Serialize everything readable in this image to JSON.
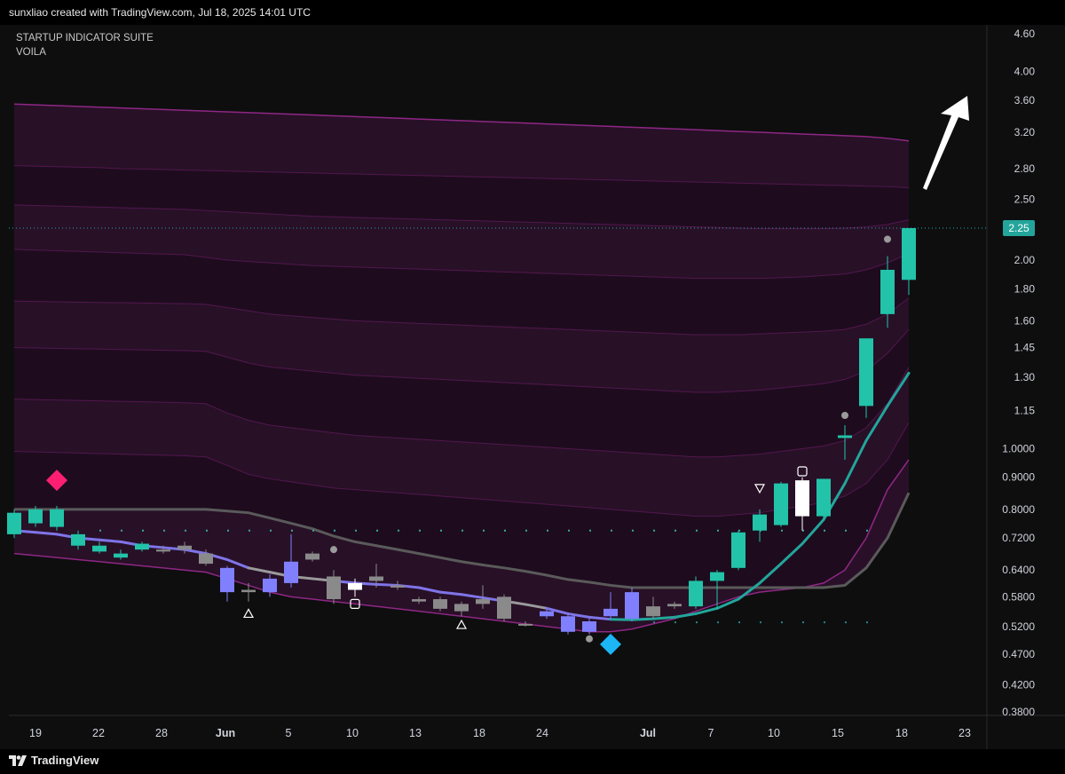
{
  "header": {
    "text": "sunxliao created with TradingView.com, Jul 18, 2025 14:01 UTC"
  },
  "legend": {
    "line1": "STARTUP INDICATOR SUITE",
    "line2": "VOILA"
  },
  "footer": {
    "brand": "TradingView"
  },
  "colors": {
    "bull": "#22c3a9",
    "bear_purple": "#8080ff",
    "neutral": "#8a8a8a",
    "white_candle": "#ffffff",
    "band_fill": "#2a1129",
    "band_line": "#7a1f72",
    "ema_teal": "#23a59b",
    "mid_line": "#5a5a5a",
    "diamond_pink": "#ff1f72",
    "diamond_blue": "#1cb6f5",
    "price_label": "#23a59b"
  },
  "chart_data": {
    "type": "candlestick",
    "y_scale": "log",
    "ylim": [
      0.375,
      4.75
    ],
    "y_ticks": [
      "4.60",
      "4.00",
      "3.60",
      "3.20",
      "2.80",
      "2.50",
      "2.25",
      "2.00",
      "1.80",
      "1.60",
      "1.45",
      "1.30",
      "1.15",
      "1.0000",
      "0.9000",
      "0.8000",
      "0.7200",
      "0.6400",
      "0.5800",
      "0.5200",
      "0.4700",
      "0.4200",
      "0.3800"
    ],
    "x_ticks": [
      "19",
      "22",
      "28",
      "Jun",
      "5",
      "10",
      "13",
      "18",
      "24",
      "Jul",
      "7",
      "10",
      "15",
      "18",
      "23"
    ],
    "last_price": "2.25",
    "candles": [
      {
        "open": 0.73,
        "close": 0.79,
        "high": 0.8,
        "low": 0.72,
        "color": "bull"
      },
      {
        "open": 0.76,
        "close": 0.8,
        "high": 0.81,
        "low": 0.75,
        "color": "bull"
      },
      {
        "open": 0.75,
        "close": 0.8,
        "high": 0.81,
        "low": 0.74,
        "color": "bull"
      },
      {
        "open": 0.73,
        "close": 0.7,
        "high": 0.74,
        "low": 0.69,
        "color": "bull"
      },
      {
        "open": 0.7,
        "close": 0.685,
        "high": 0.71,
        "low": 0.68,
        "color": "bull"
      },
      {
        "open": 0.68,
        "close": 0.67,
        "high": 0.69,
        "low": 0.665,
        "color": "bull"
      },
      {
        "open": 0.69,
        "close": 0.705,
        "high": 0.71,
        "low": 0.685,
        "color": "bull"
      },
      {
        "open": 0.69,
        "close": 0.685,
        "high": 0.7,
        "low": 0.68,
        "color": "neutral"
      },
      {
        "open": 0.7,
        "close": 0.69,
        "high": 0.71,
        "low": 0.68,
        "color": "neutral"
      },
      {
        "open": 0.68,
        "close": 0.655,
        "high": 0.69,
        "low": 0.65,
        "color": "neutral"
      },
      {
        "open": 0.645,
        "close": 0.59,
        "high": 0.65,
        "low": 0.57,
        "color": "bear_purple"
      },
      {
        "open": 0.595,
        "close": 0.59,
        "high": 0.61,
        "low": 0.57,
        "color": "neutral"
      },
      {
        "open": 0.62,
        "close": 0.59,
        "high": 0.63,
        "low": 0.58,
        "color": "bear_purple"
      },
      {
        "open": 0.66,
        "close": 0.61,
        "high": 0.73,
        "low": 0.6,
        "color": "bear_purple"
      },
      {
        "open": 0.665,
        "close": 0.68,
        "high": 0.685,
        "low": 0.66,
        "color": "neutral"
      },
      {
        "open": 0.625,
        "close": 0.575,
        "high": 0.64,
        "low": 0.565,
        "color": "neutral"
      },
      {
        "open": 0.61,
        "close": 0.595,
        "high": 0.62,
        "low": 0.58,
        "color": "white_candle"
      },
      {
        "open": 0.625,
        "close": 0.615,
        "high": 0.655,
        "low": 0.6,
        "color": "neutral"
      },
      {
        "open": 0.605,
        "close": 0.6,
        "high": 0.615,
        "low": 0.595,
        "color": "neutral"
      },
      {
        "open": 0.575,
        "close": 0.57,
        "high": 0.58,
        "low": 0.565,
        "color": "neutral"
      },
      {
        "open": 0.575,
        "close": 0.555,
        "high": 0.58,
        "low": 0.55,
        "color": "neutral"
      },
      {
        "open": 0.565,
        "close": 0.55,
        "high": 0.57,
        "low": 0.54,
        "color": "neutral"
      },
      {
        "open": 0.575,
        "close": 0.565,
        "high": 0.605,
        "low": 0.555,
        "color": "neutral"
      },
      {
        "open": 0.58,
        "close": 0.535,
        "high": 0.585,
        "low": 0.53,
        "color": "neutral"
      },
      {
        "open": 0.525,
        "close": 0.525,
        "high": 0.53,
        "low": 0.52,
        "color": "neutral"
      },
      {
        "open": 0.55,
        "close": 0.54,
        "high": 0.555,
        "low": 0.535,
        "color": "bear_purple"
      },
      {
        "open": 0.54,
        "close": 0.51,
        "high": 0.545,
        "low": 0.505,
        "color": "bear_purple"
      },
      {
        "open": 0.53,
        "close": 0.51,
        "high": 0.535,
        "low": 0.505,
        "color": "bear_purple"
      },
      {
        "open": 0.555,
        "close": 0.54,
        "high": 0.59,
        "low": 0.535,
        "color": "bear_purple"
      },
      {
        "open": 0.59,
        "close": 0.535,
        "high": 0.6,
        "low": 0.53,
        "color": "bear_purple"
      },
      {
        "open": 0.56,
        "close": 0.54,
        "high": 0.58,
        "low": 0.535,
        "color": "neutral"
      },
      {
        "open": 0.56,
        "close": 0.565,
        "high": 0.57,
        "low": 0.555,
        "color": "neutral"
      },
      {
        "open": 0.56,
        "close": 0.615,
        "high": 0.625,
        "low": 0.555,
        "color": "bull"
      },
      {
        "open": 0.615,
        "close": 0.635,
        "high": 0.64,
        "low": 0.555,
        "color": "bull"
      },
      {
        "open": 0.645,
        "close": 0.735,
        "high": 0.74,
        "low": 0.64,
        "color": "bull"
      },
      {
        "open": 0.74,
        "close": 0.785,
        "high": 0.8,
        "low": 0.71,
        "color": "bull"
      },
      {
        "open": 0.755,
        "close": 0.88,
        "high": 0.885,
        "low": 0.75,
        "color": "bull"
      },
      {
        "open": 0.78,
        "close": 0.89,
        "high": 0.9,
        "low": 0.74,
        "color": "white_candle"
      },
      {
        "open": 0.78,
        "close": 0.895,
        "high": 0.895,
        "low": 0.77,
        "color": "bull"
      },
      {
        "open": 1.04,
        "close": 1.05,
        "high": 1.09,
        "low": 0.96,
        "color": "bull"
      },
      {
        "open": 1.17,
        "close": 1.5,
        "high": 1.5,
        "low": 1.12,
        "color": "bull"
      },
      {
        "open": 1.64,
        "close": 1.93,
        "high": 2.03,
        "low": 1.56,
        "color": "bull"
      },
      {
        "open": 1.86,
        "close": 2.25,
        "high": 2.25,
        "low": 1.76,
        "color": "bull"
      }
    ],
    "ema": [
      0.74,
      0.735,
      0.73,
      0.72,
      0.715,
      0.71,
      0.7,
      0.695,
      0.69,
      0.68,
      0.665,
      0.645,
      0.635,
      0.625,
      0.62,
      0.615,
      0.61,
      0.607,
      0.605,
      0.6,
      0.59,
      0.585,
      0.578,
      0.571,
      0.564,
      0.556,
      0.545,
      0.538,
      0.534,
      0.533,
      0.535,
      0.538,
      0.545,
      0.556,
      0.575,
      0.61,
      0.655,
      0.705,
      0.77,
      0.88,
      1.03,
      1.17,
      1.32
    ],
    "ema_colors": [
      "bear_purple",
      "bear_purple",
      "bear_purple",
      "bear_purple",
      "bear_purple",
      "bear_purple",
      "bear_purple",
      "bear_purple",
      "bear_purple",
      "bear_purple",
      "bear_purple",
      "bear_purple",
      "neutral",
      "neutral",
      "neutral",
      "neutral",
      "bear_purple",
      "bear_purple",
      "bear_purple",
      "bear_purple",
      "bear_purple",
      "bear_purple",
      "bear_purple",
      "bear_purple",
      "neutral",
      "neutral",
      "bear_purple",
      "bear_purple",
      "bear_purple",
      "bull",
      "bull",
      "bull",
      "bull",
      "bull",
      "bull",
      "bull",
      "bull",
      "bull",
      "bull",
      "bull",
      "bull",
      "bull",
      "bull"
    ],
    "mid_line": [
      0.8,
      0.8,
      0.8,
      0.8,
      0.8,
      0.8,
      0.8,
      0.8,
      0.8,
      0.8,
      0.795,
      0.79,
      0.775,
      0.76,
      0.745,
      0.725,
      0.71,
      0.7,
      0.69,
      0.68,
      0.67,
      0.66,
      0.652,
      0.645,
      0.637,
      0.628,
      0.618,
      0.612,
      0.605,
      0.6,
      0.6,
      0.6,
      0.6,
      0.6,
      0.6,
      0.6,
      0.6,
      0.6,
      0.6,
      0.605,
      0.645,
      0.72,
      0.85
    ],
    "bands": [
      {
        "name": "b1",
        "values": [
          3.55,
          3.54,
          3.53,
          3.52,
          3.51,
          3.5,
          3.49,
          3.48,
          3.47,
          3.46,
          3.45,
          3.44,
          3.43,
          3.42,
          3.41,
          3.4,
          3.39,
          3.38,
          3.37,
          3.36,
          3.35,
          3.34,
          3.33,
          3.32,
          3.31,
          3.3,
          3.29,
          3.28,
          3.27,
          3.26,
          3.25,
          3.24,
          3.23,
          3.22,
          3.21,
          3.2,
          3.19,
          3.18,
          3.17,
          3.16,
          3.15,
          3.13,
          3.1
        ]
      },
      {
        "name": "b2",
        "values": [
          2.83,
          2.825,
          2.82,
          2.815,
          2.81,
          2.8,
          2.795,
          2.79,
          2.785,
          2.78,
          2.775,
          2.77,
          2.765,
          2.76,
          2.755,
          2.75,
          2.745,
          2.74,
          2.735,
          2.73,
          2.725,
          2.72,
          2.715,
          2.71,
          2.705,
          2.7,
          2.695,
          2.69,
          2.685,
          2.68,
          2.675,
          2.67,
          2.665,
          2.66,
          2.655,
          2.65,
          2.645,
          2.64,
          2.635,
          2.63,
          2.625,
          2.62,
          2.61
        ]
      },
      {
        "name": "b3",
        "values": [
          2.45,
          2.445,
          2.44,
          2.435,
          2.43,
          2.425,
          2.42,
          2.415,
          2.41,
          2.4,
          2.39,
          2.38,
          2.37,
          2.36,
          2.35,
          2.345,
          2.34,
          2.335,
          2.33,
          2.325,
          2.32,
          2.315,
          2.31,
          2.305,
          2.3,
          2.295,
          2.29,
          2.285,
          2.28,
          2.275,
          2.27,
          2.265,
          2.26,
          2.255,
          2.25,
          2.245,
          2.245,
          2.245,
          2.245,
          2.25,
          2.26,
          2.28,
          2.32
        ]
      },
      {
        "name": "b4",
        "values": [
          2.08,
          2.075,
          2.07,
          2.065,
          2.06,
          2.055,
          2.05,
          2.045,
          2.04,
          2.02,
          2.0,
          1.99,
          1.98,
          1.97,
          1.96,
          1.955,
          1.95,
          1.945,
          1.94,
          1.935,
          1.93,
          1.925,
          1.92,
          1.915,
          1.91,
          1.905,
          1.9,
          1.895,
          1.89,
          1.885,
          1.88,
          1.875,
          1.87,
          1.87,
          1.87,
          1.87,
          1.875,
          1.88,
          1.89,
          1.9,
          1.93,
          1.98,
          2.05
        ]
      },
      {
        "name": "b5",
        "values": [
          1.72,
          1.718,
          1.716,
          1.714,
          1.712,
          1.71,
          1.708,
          1.706,
          1.704,
          1.7,
          1.68,
          1.66,
          1.64,
          1.63,
          1.62,
          1.61,
          1.6,
          1.595,
          1.59,
          1.585,
          1.58,
          1.575,
          1.57,
          1.565,
          1.56,
          1.555,
          1.55,
          1.545,
          1.54,
          1.535,
          1.53,
          1.525,
          1.52,
          1.52,
          1.52,
          1.525,
          1.53,
          1.535,
          1.54,
          1.55,
          1.58,
          1.64,
          1.74
        ]
      },
      {
        "name": "b6",
        "values": [
          1.45,
          1.448,
          1.446,
          1.444,
          1.442,
          1.44,
          1.438,
          1.436,
          1.434,
          1.43,
          1.4,
          1.37,
          1.35,
          1.34,
          1.33,
          1.32,
          1.31,
          1.305,
          1.3,
          1.295,
          1.29,
          1.285,
          1.28,
          1.275,
          1.27,
          1.265,
          1.26,
          1.255,
          1.25,
          1.245,
          1.24,
          1.235,
          1.23,
          1.23,
          1.235,
          1.24,
          1.25,
          1.26,
          1.27,
          1.29,
          1.33,
          1.42,
          1.55
        ]
      },
      {
        "name": "b7",
        "values": [
          1.2,
          1.198,
          1.196,
          1.194,
          1.192,
          1.19,
          1.188,
          1.186,
          1.184,
          1.18,
          1.14,
          1.11,
          1.09,
          1.08,
          1.07,
          1.06,
          1.05,
          1.045,
          1.04,
          1.035,
          1.03,
          1.025,
          1.02,
          1.015,
          1.01,
          1.005,
          1.0,
          0.995,
          0.99,
          0.985,
          0.98,
          0.975,
          0.97,
          0.97,
          0.975,
          0.98,
          0.99,
          1.0,
          1.01,
          1.03,
          1.08,
          1.18,
          1.35
        ]
      },
      {
        "name": "b8",
        "values": [
          0.99,
          0.988,
          0.986,
          0.984,
          0.982,
          0.98,
          0.978,
          0.976,
          0.974,
          0.97,
          0.94,
          0.91,
          0.895,
          0.885,
          0.875,
          0.865,
          0.86,
          0.855,
          0.85,
          0.845,
          0.84,
          0.835,
          0.83,
          0.825,
          0.82,
          0.815,
          0.81,
          0.805,
          0.8,
          0.795,
          0.79,
          0.785,
          0.78,
          0.78,
          0.785,
          0.79,
          0.8,
          0.81,
          0.82,
          0.84,
          0.88,
          0.96,
          1.1
        ]
      },
      {
        "name": "b9",
        "values": [
          0.8,
          0.8,
          0.8,
          0.8,
          0.8,
          0.8,
          0.8,
          0.8,
          0.8,
          0.8,
          0.795,
          0.79,
          0.775,
          0.76,
          0.745,
          0.725,
          0.71,
          0.7,
          0.69,
          0.68,
          0.67,
          0.66,
          0.652,
          0.645,
          0.637,
          0.628,
          0.618,
          0.612,
          0.605,
          0.6,
          0.6,
          0.6,
          0.6,
          0.6,
          0.6,
          0.6,
          0.6,
          0.6,
          0.6,
          0.605,
          0.645,
          0.72,
          0.85
        ]
      },
      {
        "name": "b10",
        "values": [
          0.68,
          0.675,
          0.67,
          0.665,
          0.66,
          0.655,
          0.65,
          0.645,
          0.64,
          0.635,
          0.62,
          0.605,
          0.59,
          0.58,
          0.575,
          0.57,
          0.565,
          0.56,
          0.555,
          0.55,
          0.545,
          0.54,
          0.535,
          0.53,
          0.525,
          0.52,
          0.515,
          0.51,
          0.51,
          0.515,
          0.525,
          0.535,
          0.55,
          0.565,
          0.58,
          0.59,
          0.595,
          0.6,
          0.61,
          0.64,
          0.72,
          0.86,
          0.96
        ]
      }
    ],
    "markers": [
      {
        "type": "diamond",
        "index": 2,
        "price": 0.89,
        "color": "diamond_pink"
      },
      {
        "type": "diamond",
        "index": 28,
        "price": 0.487,
        "color": "diamond_blue"
      },
      {
        "type": "triangle-up",
        "index": 11,
        "price": 0.545
      },
      {
        "type": "triangle-up",
        "index": 21,
        "price": 0.523
      },
      {
        "type": "square",
        "index": 16,
        "price": 0.565
      },
      {
        "type": "square",
        "index": 37,
        "price": 0.92
      },
      {
        "type": "triangle-down",
        "index": 35,
        "price": 0.865
      },
      {
        "type": "dot",
        "index": 15,
        "price": 0.69
      },
      {
        "type": "dot",
        "index": 27,
        "price": 0.497
      },
      {
        "type": "dot",
        "index": 39,
        "price": 1.13
      },
      {
        "type": "dot",
        "index": 41,
        "price": 2.16
      }
    ],
    "dotted_levels": [
      {
        "price": 0.74,
        "from": 4,
        "to": 41
      },
      {
        "price": 0.528,
        "from": 30,
        "to": 41
      }
    ]
  }
}
